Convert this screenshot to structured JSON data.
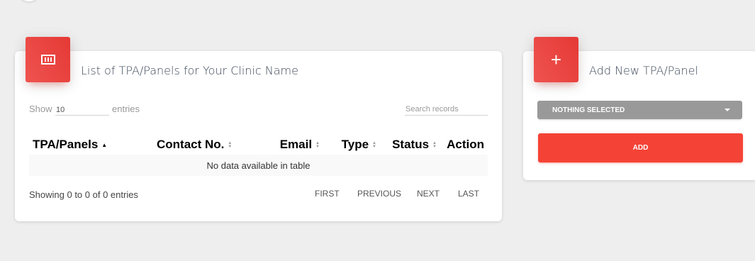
{
  "list_card": {
    "title": "List of TPA/Panels for Your Clinic Name",
    "icon": "table-icon",
    "show_label": "Show",
    "page_length": "10",
    "entries_label": "entries",
    "search_placeholder": "Search records",
    "columns": [
      {
        "label": "TPA/Panels",
        "sort": "asc"
      },
      {
        "label": "Contact No.",
        "sort": "both"
      },
      {
        "label": "Email",
        "sort": "both"
      },
      {
        "label": "Type",
        "sort": "both"
      },
      {
        "label": "Status",
        "sort": "both"
      },
      {
        "label": "Action",
        "sort": "none"
      }
    ],
    "empty_message": "No data available in table",
    "info": "Showing 0 to 0 of 0 entries",
    "pagination": {
      "first": "FIRST",
      "previous": "PREVIOUS",
      "next": "NEXT",
      "last": "LAST"
    }
  },
  "add_card": {
    "title": "Add New TPA/Panel",
    "icon": "plus-icon",
    "select_value": "NOTHING SELECTED",
    "add_label": "ADD"
  },
  "colors": {
    "accent": "#f44336",
    "select_bg": "#999999",
    "background": "#eeeeee"
  }
}
